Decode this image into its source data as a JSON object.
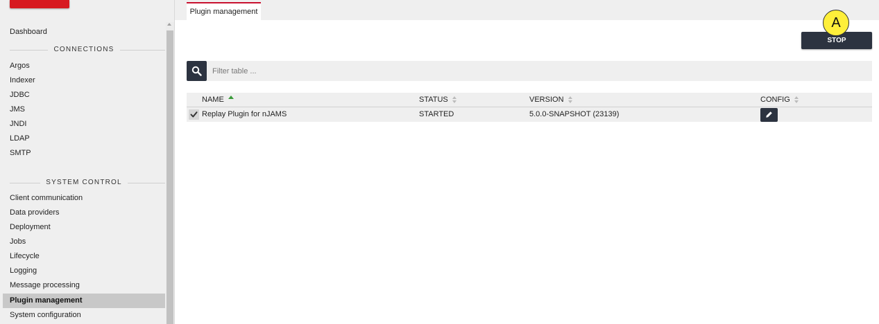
{
  "sidebar": {
    "top_item": "Dashboard",
    "sections": [
      {
        "title": "CONNECTIONS",
        "items": [
          "Argos",
          "Indexer",
          "JDBC",
          "JMS",
          "JNDI",
          "LDAP",
          "SMTP"
        ]
      },
      {
        "title": "SYSTEM CONTROL",
        "items": [
          "Client communication",
          "Data providers",
          "Deployment",
          "Jobs",
          "Lifecycle",
          "Logging",
          "Message processing",
          "Plugin management",
          "System configuration"
        ]
      }
    ],
    "active_item": "Plugin management"
  },
  "tab": {
    "label": "Plugin management"
  },
  "toolbar": {
    "stop_label": "STOP",
    "marker_label": "A"
  },
  "filter": {
    "placeholder": "Filter table ..."
  },
  "table": {
    "columns": [
      "NAME",
      "STATUS",
      "VERSION",
      "CONFIG"
    ],
    "sorted_column": "NAME",
    "rows": [
      {
        "name": "Replay Plugin for nJAMS",
        "status": "STARTED",
        "version": "5.0.0-SNAPSHOT (23139)",
        "selected": true
      }
    ]
  },
  "colors": {
    "brand": "#d71920",
    "accent": "#c8102e",
    "dark_button": "#2c3340",
    "marker": "#ffef3a",
    "sort_active": "#3a9a3a"
  },
  "icons": {
    "search": "search-icon",
    "check": "check-icon",
    "edit": "pencil-icon"
  }
}
